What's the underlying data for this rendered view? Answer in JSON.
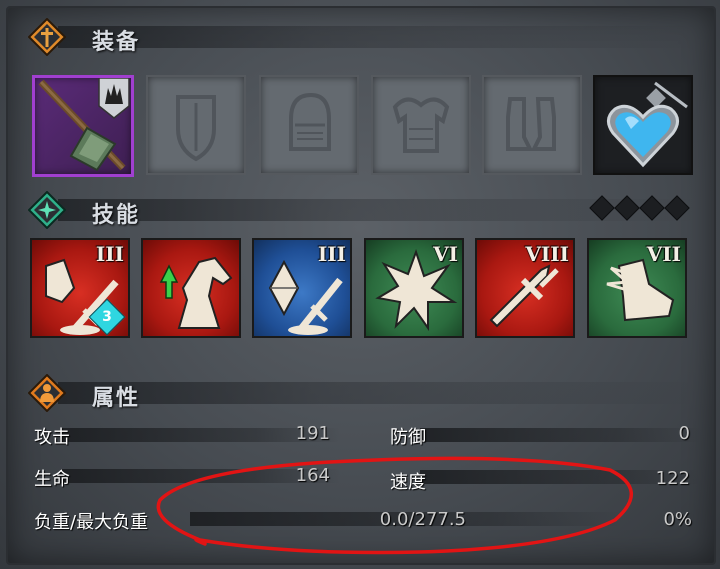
{
  "sections": {
    "equipment": {
      "title": "装备"
    },
    "skills": {
      "title": "技能"
    },
    "attributes": {
      "title": "属性"
    }
  },
  "equipment_slots": [
    {
      "name": "weapon",
      "state": "equipped",
      "icon": "spear-icon"
    },
    {
      "name": "shield",
      "state": "empty",
      "icon": "shield-icon"
    },
    {
      "name": "helmet",
      "state": "empty",
      "icon": "helmet-icon"
    },
    {
      "name": "armor",
      "state": "empty",
      "icon": "armor-icon"
    },
    {
      "name": "boots",
      "state": "empty",
      "icon": "boots-icon"
    },
    {
      "name": "charm",
      "state": "equipped",
      "icon": "heart-gem-icon"
    }
  ],
  "skills": [
    {
      "rank": "III",
      "color": "red",
      "icon": "boot-sword-icon",
      "badge": "3"
    },
    {
      "rank": "",
      "color": "red",
      "icon": "horse-up-icon"
    },
    {
      "rank": "III",
      "color": "blue",
      "icon": "crystal-sword-icon"
    },
    {
      "rank": "VI",
      "color": "green",
      "icon": "burst-icon"
    },
    {
      "rank": "VIII",
      "color": "red",
      "icon": "sword-icon"
    },
    {
      "rank": "VII",
      "color": "green",
      "icon": "winged-boot-icon"
    }
  ],
  "skill_slots_empty": 4,
  "attributes": {
    "attack": {
      "label": "攻击",
      "value": "191"
    },
    "defense": {
      "label": "防御",
      "value": "0"
    },
    "life": {
      "label": "生命",
      "value": "164"
    },
    "speed": {
      "label": "速度",
      "value": "122"
    },
    "load": {
      "label": "负重/最大负重",
      "value": "0.0/277.5",
      "percent": "0%"
    }
  },
  "colors": {
    "selected_border": "#a13fd0",
    "header_icon_bg": "#e08a2a",
    "annotation": "#e21414"
  }
}
